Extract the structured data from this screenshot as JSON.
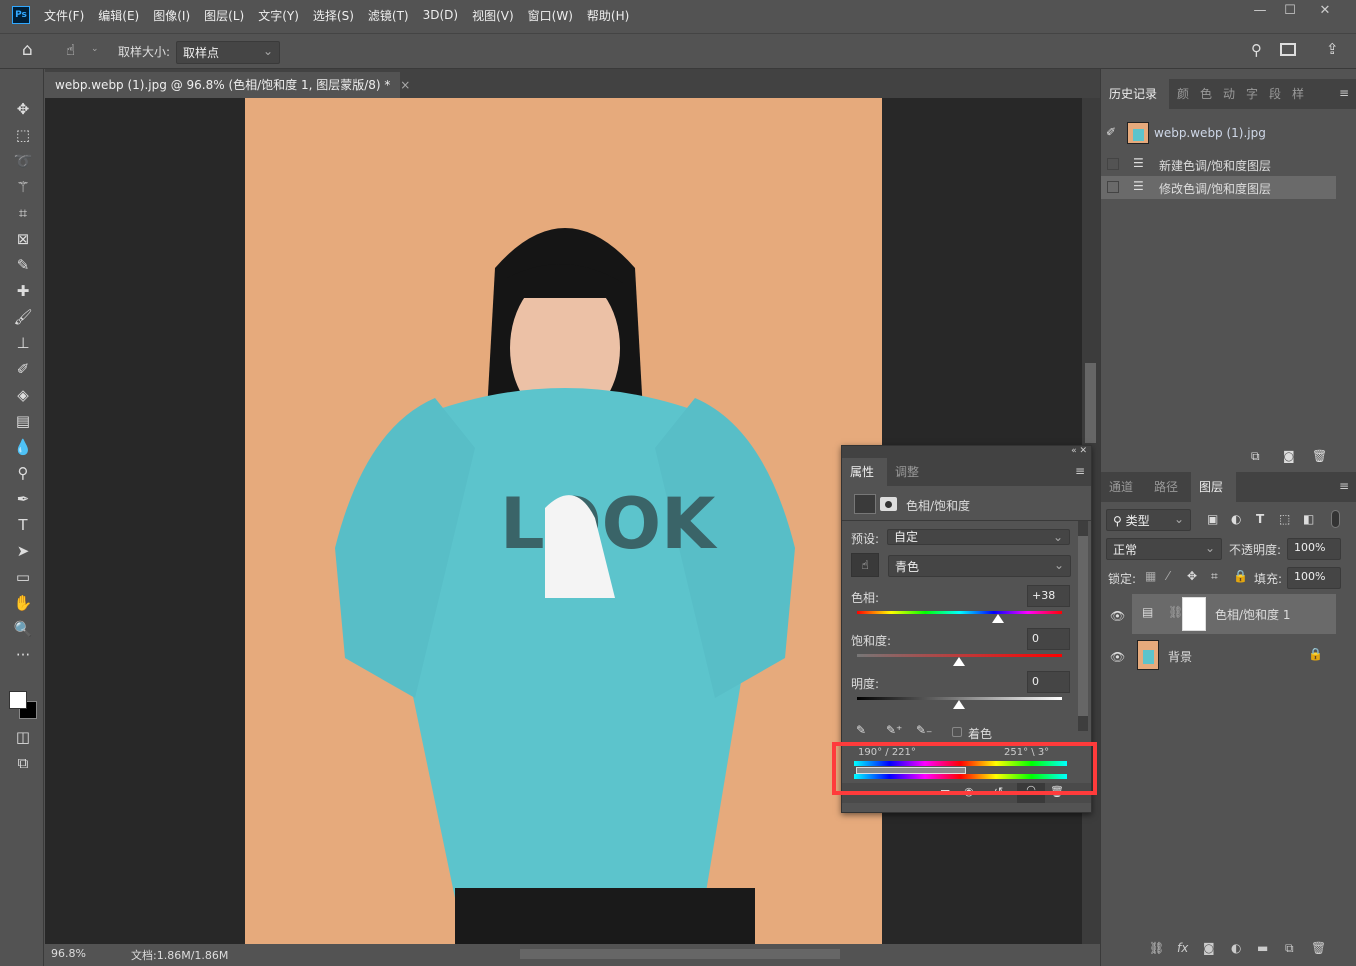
{
  "app": {
    "logo": "Ps",
    "menu": [
      "文件(F)",
      "编辑(E)",
      "图像(I)",
      "图层(L)",
      "文字(Y)",
      "选择(S)",
      "滤镜(T)",
      "3D(D)",
      "视图(V)",
      "窗口(W)",
      "帮助(H)"
    ],
    "window_buttons": [
      "—",
      "☐",
      "✕"
    ]
  },
  "options": {
    "sample_size_label": "取样大小:",
    "sample_size_value": "取样点"
  },
  "document": {
    "tab_title": "webp.webp (1).jpg @ 96.8% (色相/饱和度 1, 图层蒙版/8) *",
    "close": "×"
  },
  "status": {
    "zoom": "96.8%",
    "doc_info": "文档:1.86M/1.86M"
  },
  "history_panel": {
    "tabs": [
      "历史记录",
      "颜",
      "色",
      "动",
      "字",
      "段",
      "样"
    ],
    "snapshot": "webp.webp (1).jpg",
    "items": [
      "新建色调/饱和度图层",
      "修改色调/饱和度图层"
    ],
    "selected_index": 1
  },
  "layers_panel": {
    "tabs": [
      "通道",
      "路径",
      "图层"
    ],
    "active_tab": 2,
    "filter": "类型",
    "blend_mode": "正常",
    "opacity_label": "不透明度:",
    "opacity": "100%",
    "lock_label": "锁定:",
    "fill_label": "填充:",
    "fill": "100%",
    "layers": [
      {
        "name": "色相/饱和度 1",
        "selected": true
      },
      {
        "name": "背景",
        "locked": true
      }
    ]
  },
  "properties_panel": {
    "tabs": [
      "属性",
      "调整"
    ],
    "title": "色相/饱和度",
    "preset_label": "预设:",
    "preset": "自定",
    "channel": "青色",
    "hue_label": "色相:",
    "hue": "+38",
    "hue_fraction": 0.69,
    "saturation_label": "饱和度:",
    "saturation": "0",
    "lightness_label": "明度:",
    "lightness": "0",
    "colorize_label": "着色",
    "colorize": false,
    "range_left": "190° / 221°",
    "range_right": "251° \\ 3°"
  },
  "highlight_color": "#ff3b3b"
}
